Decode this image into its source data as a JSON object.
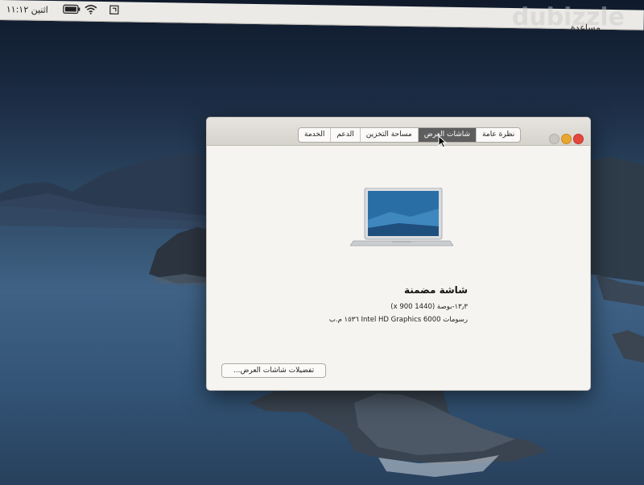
{
  "menubar": {
    "clock": "اثنين ١١:١٢",
    "help_menu": "مساعدة",
    "wifi_icon": "wifi-icon",
    "battery_icon": "battery-icon"
  },
  "watermark": "dubizzle",
  "window": {
    "tabs": [
      {
        "label": "الخدمة",
        "active": false
      },
      {
        "label": "الدعم",
        "active": false
      },
      {
        "label": "مساحة التخزين",
        "active": false
      },
      {
        "label": "شاشات العرض",
        "active": true
      },
      {
        "label": "نظرة عامة",
        "active": false
      }
    ],
    "display": {
      "name": "شاشة مضمنة",
      "size": "١٣٫٣-بوصة (1440 x 900)",
      "graphics": "رسومات Intel HD Graphics 6000 ١٥٣٦ م.ب"
    },
    "details_button": "تفضيلات شاشات العرض..."
  },
  "colors": {
    "close": "#e2463f",
    "minimize": "#e8a531",
    "active_tab": "#5e5e5e"
  }
}
